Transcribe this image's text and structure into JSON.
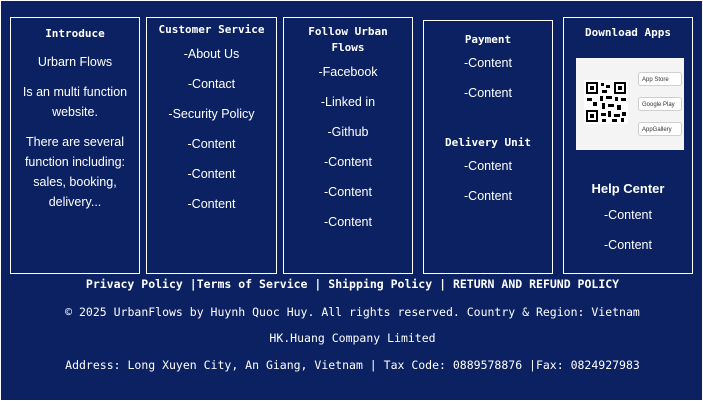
{
  "introduce": {
    "title": "Introduce",
    "brand": "Urbarn Flows",
    "desc1": "Is an multi function website.",
    "desc2": "There are several function including: sales, booking, delivery..."
  },
  "customer_service": {
    "title": "Customer Service",
    "items": [
      "-About Us",
      "-Contact",
      "-Security Policy",
      "-Content",
      "-Content",
      "-Content"
    ]
  },
  "follow": {
    "title": "Follow Urban Flows",
    "items": [
      "-Facebook",
      "-Linked in",
      "-Github",
      "-Content",
      "-Content",
      "-Content"
    ]
  },
  "payment": {
    "title": "Payment",
    "items": [
      "-Content",
      "-Content"
    ],
    "delivery_title": "Delivery Unit",
    "delivery_items": [
      "-Content",
      "-Content"
    ]
  },
  "apps": {
    "title": "Download Apps",
    "stores": [
      "App Store",
      "Google Play",
      "AppGallery"
    ],
    "help_title": "Help Center",
    "help_items": [
      "-Content",
      "-Content"
    ]
  },
  "policy_links": {
    "privacy": "Privacy Policy",
    "terms": "Terms of Service",
    "shipping": "Shipping Policy",
    "refund": "RETURN AND REFUND POLICY"
  },
  "copyright": "© 2025 UrbanFlows by Huynh Quoc Huy. All rights reserved.  Country & Region: Vietnam",
  "company": "HK.Huang Company Limited",
  "address": "Address: Long Xuyen City, An Giang, Vietnam | Tax Code: 0889578876 |Fax: 0824927983",
  "colors": {
    "background": "#0b2161",
    "text": "#ffffff"
  }
}
